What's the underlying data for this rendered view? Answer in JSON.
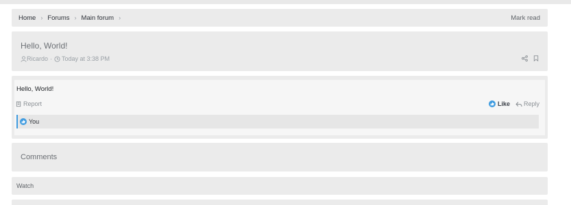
{
  "breadcrumb": {
    "items": [
      "Home",
      "Forums",
      "Main forum"
    ],
    "mark_read": "Mark read"
  },
  "thread": {
    "title": "Hello, World!",
    "author": "Ricardo",
    "time": "Today at 3:38 PM"
  },
  "post": {
    "body": "Hello, World!",
    "report_label": "Report",
    "like_label": "Like",
    "reply_label": "Reply",
    "reaction_users": "You"
  },
  "comments": {
    "heading": "Comments"
  },
  "watch": {
    "label": "Watch"
  },
  "icons": {
    "user": "user-icon",
    "clock": "clock-icon",
    "share": "share-icon",
    "bookmark": "bookmark-icon",
    "report": "report-icon",
    "like": "like-icon",
    "reply": "reply-icon"
  },
  "colors": {
    "accent": "#3e9be0",
    "card": "#ebebeb"
  }
}
